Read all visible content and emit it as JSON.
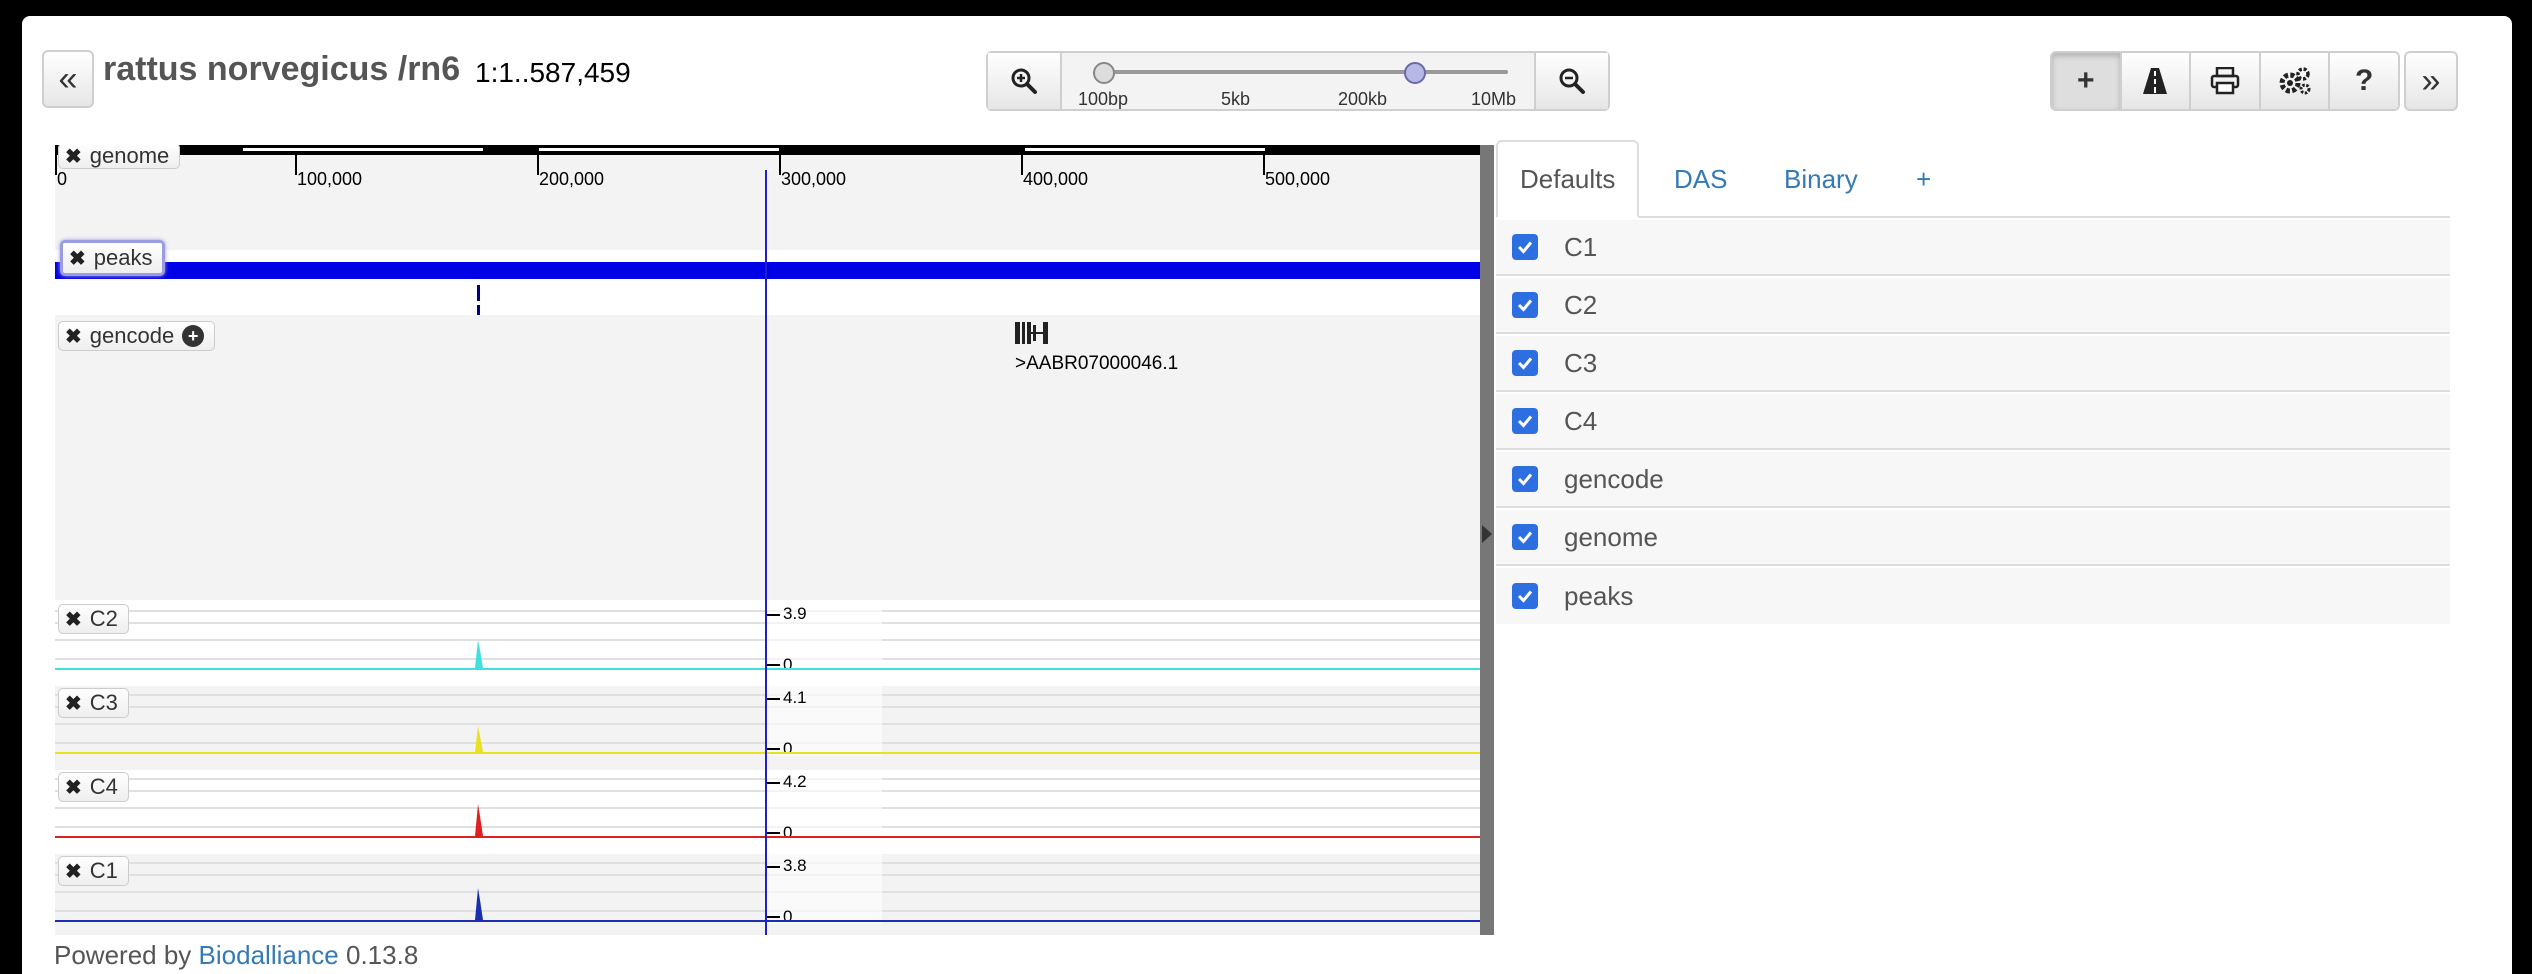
{
  "header": {
    "collapse_left_label": "«",
    "title": "rattus norvegicus /rn6",
    "location": "1:1..587,459",
    "collapse_right_label": "»"
  },
  "zoom": {
    "labels": [
      "100bp",
      "5kb",
      "200kb",
      "10Mb"
    ],
    "level_fraction": 0.76
  },
  "toolbar": {
    "buttons": [
      "plus-icon",
      "road-icon",
      "print-icon",
      "gears-icon",
      "help-icon"
    ],
    "help_label": "?"
  },
  "ruler": {
    "ticks": [
      "0",
      "100,000",
      "200,000",
      "300,000",
      "400,000",
      "500,000"
    ]
  },
  "tracks": {
    "genome": {
      "name": "genome"
    },
    "peaks": {
      "name": "peaks"
    },
    "gencode": {
      "name": "gencode",
      "feature_label": ">AABR07000046.1"
    },
    "C2": {
      "name": "C2",
      "max": "3.9",
      "min": "0",
      "color": "#40e0e0"
    },
    "C3": {
      "name": "C3",
      "max": "4.1",
      "min": "0",
      "color": "#e8e020"
    },
    "C4": {
      "name": "C4",
      "max": "4.2",
      "min": "0",
      "color": "#e02020"
    },
    "C1": {
      "name": "C1",
      "max": "3.8",
      "min": "0",
      "color": "#1a2fb0"
    }
  },
  "panel": {
    "tabs": [
      "Defaults",
      "DAS",
      "Binary",
      "+"
    ],
    "rows": [
      "C1",
      "C2",
      "C3",
      "C4",
      "gencode",
      "genome",
      "peaks"
    ]
  },
  "footer": {
    "prefix": "Powered by",
    "link": "Biodalliance",
    "version": "0.13.8"
  },
  "colors": {
    "accent": "#337ab7",
    "peaks_bar": "#0000e6",
    "cursor": "#2020c8"
  }
}
